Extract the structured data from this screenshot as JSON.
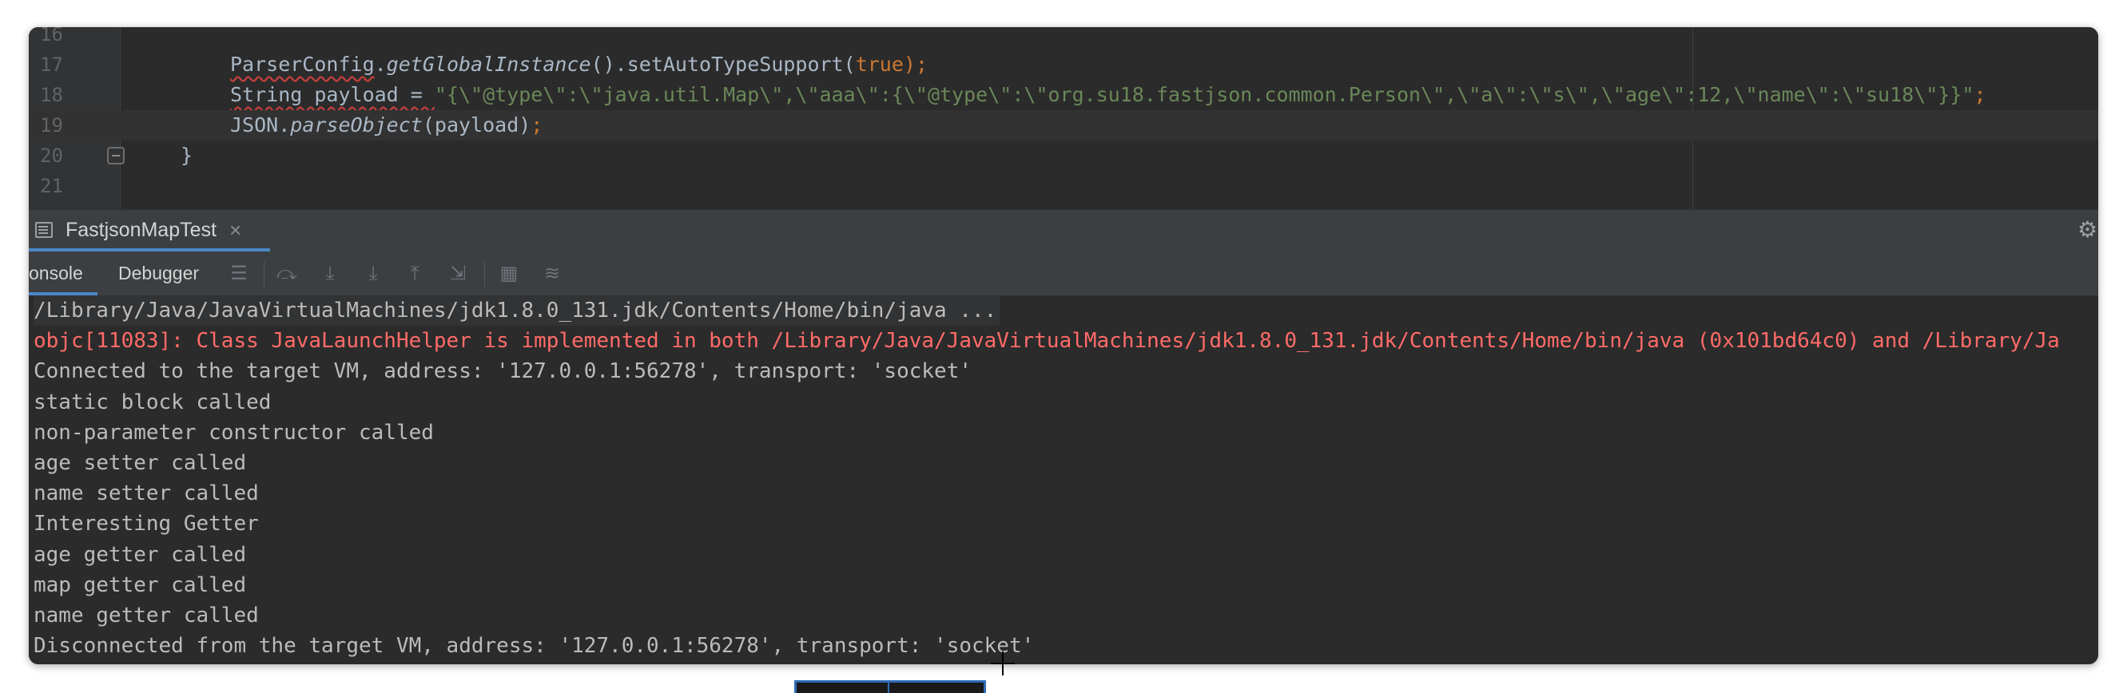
{
  "editor": {
    "lines": [
      {
        "num": "16",
        "segments": []
      },
      {
        "num": "17",
        "segments": [
          {
            "t": "ParserConfig",
            "c": "c-cls underline-red"
          },
          {
            "t": ".",
            "c": "c-cls"
          },
          {
            "t": "getGlobalInstance",
            "c": "c-meth"
          },
          {
            "t": "().setAutoTypeSupport(",
            "c": "c-cls"
          },
          {
            "t": "true",
            "c": "c-kw"
          },
          {
            "t": ");",
            "c": "c-kw"
          }
        ]
      },
      {
        "num": "18",
        "segments": [
          {
            "t": "String payload = ",
            "c": "c-cls underline-red"
          },
          {
            "t": "\"{\\\"@type\\\":\\\"java.util.Map\\\",\\\"aaa\\\":{\\\"@type\\\":\\\"org.su18.fastjson.common.Person\\\",\\\"a\\\":\\\"s\\\",\\\"age\\\":12,\\\"name\\\":\\\"su18\\\"}}\"",
            "c": "c-str"
          },
          {
            "t": ";",
            "c": "c-kw"
          }
        ]
      },
      {
        "num": "19",
        "segments": [
          {
            "t": "JSON.",
            "c": "c-cls"
          },
          {
            "t": "parseObject",
            "c": "c-meth"
          },
          {
            "t": "(payload)",
            "c": "c-cls"
          },
          {
            "t": ";",
            "c": "c-kw"
          }
        ]
      },
      {
        "num": "20",
        "segments": [
          {
            "t": "}",
            "c": "c-cls"
          }
        ]
      },
      {
        "num": "21",
        "segments": []
      }
    ]
  },
  "run_window": {
    "tab_label": "FastjsonMapTest",
    "close_glyph": "×",
    "gear_glyph": "⚙"
  },
  "toolbar": {
    "console_label": "onsole",
    "debugger_label": "Debugger",
    "icons": {
      "menu": "☰",
      "step_over": "⤼",
      "step_into": "⤓",
      "force_step_into": "⤓",
      "step_out": "⤒",
      "run_to_cursor": "⇲",
      "evaluate": "▦",
      "trace": "≋"
    }
  },
  "console": {
    "lines": [
      {
        "text": "/Library/Java/JavaVirtualMachines/jdk1.8.0_131.jdk/Contents/Home/bin/java ...",
        "kind": "cmd"
      },
      {
        "text": "objc[11083]: Class JavaLaunchHelper is implemented in both /Library/Java/JavaVirtualMachines/jdk1.8.0_131.jdk/Contents/Home/bin/java (0x101bd64c0) and /Library/Ja",
        "kind": "err"
      },
      {
        "text": "Connected to the target VM, address: '127.0.0.1:56278', transport: 'socket'",
        "kind": "out"
      },
      {
        "text": "static block called",
        "kind": "out"
      },
      {
        "text": "non-parameter constructor called",
        "kind": "out"
      },
      {
        "text": "age setter called",
        "kind": "out"
      },
      {
        "text": "name setter called",
        "kind": "out"
      },
      {
        "text": "Interesting Getter",
        "kind": "out"
      },
      {
        "text": "age getter called",
        "kind": "out"
      },
      {
        "text": "map getter called",
        "kind": "out"
      },
      {
        "text": "name getter called",
        "kind": "out"
      },
      {
        "text": "Disconnected from the target VM, address: '127.0.0.1:56278', transport: 'socket'",
        "kind": "out"
      }
    ]
  },
  "colors": {
    "editor_bg": "#2b2b2b",
    "accent": "#4a88c7",
    "error_text": "#ff6b68",
    "string": "#6a8759",
    "keyword": "#cc7832"
  }
}
